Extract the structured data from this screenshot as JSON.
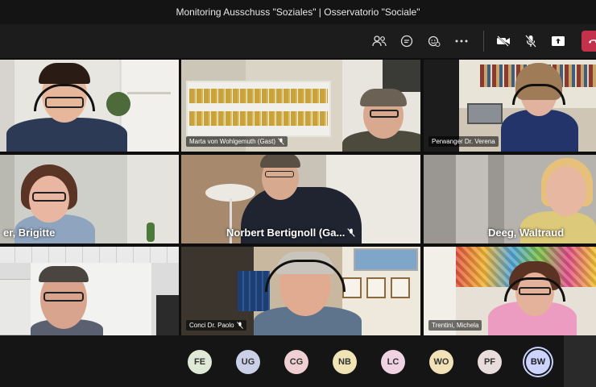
{
  "window": {
    "title": "Monitoring Ausschuss \"Soziales\" | Osservatorio \"Sociale\""
  },
  "toolbar": {
    "icons": [
      "participants-icon",
      "chat-icon",
      "reactions-icon",
      "more-icon",
      "camera-off-icon",
      "mic-off-icon",
      "share-icon",
      "leave-icon"
    ]
  },
  "participants": [
    {
      "name": "",
      "muted": false
    },
    {
      "name": "Marta von Wohlgemuth (Gast)",
      "muted": true
    },
    {
      "name": "Perwanger Dr. Verena",
      "muted": false
    },
    {
      "name": "er, Brigitte",
      "muted": false
    },
    {
      "name": "Norbert Bertignoll (Ga...",
      "muted": true
    },
    {
      "name": "Deeg, Waltraud",
      "muted": false
    },
    {
      "name": "",
      "muted": false
    },
    {
      "name": "Conci Dr. Paolo",
      "muted": true
    },
    {
      "name": "Trentini, Michela",
      "muted": false
    }
  ],
  "roster": [
    {
      "initials": "FE",
      "color": "#dfe9d6"
    },
    {
      "initials": "UG",
      "color": "#cbd0e8"
    },
    {
      "initials": "CG",
      "color": "#f0cfd2"
    },
    {
      "initials": "NB",
      "color": "#f0e3b5"
    },
    {
      "initials": "LC",
      "color": "#efd3e2"
    },
    {
      "initials": "WO",
      "color": "#f2e2b8"
    },
    {
      "initials": "PF",
      "color": "#e9dcdc"
    },
    {
      "initials": "BW",
      "color": "#ccd3ff"
    }
  ]
}
